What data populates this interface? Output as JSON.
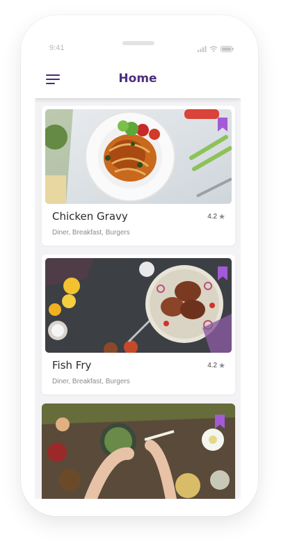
{
  "status_bar": {
    "time": "9:41"
  },
  "appbar": {
    "title": "Home"
  },
  "cards": [
    {
      "name": "Chicken Gravy",
      "tags": "Diner, Breakfast, Burgers",
      "rating": "4.2"
    },
    {
      "name": "Fish Fry",
      "tags": "Diner, Breakfast, Burgers",
      "rating": "4.2"
    },
    {
      "name": "",
      "tags": "",
      "rating": ""
    }
  ],
  "colors": {
    "brand": "#4d2f7d",
    "bookmark": "#a35ad6",
    "background": "#f3f3f5"
  },
  "icons": [
    "menu-icon",
    "bookmark-icon",
    "star-icon",
    "signal-icon",
    "wifi-icon",
    "battery-icon"
  ]
}
